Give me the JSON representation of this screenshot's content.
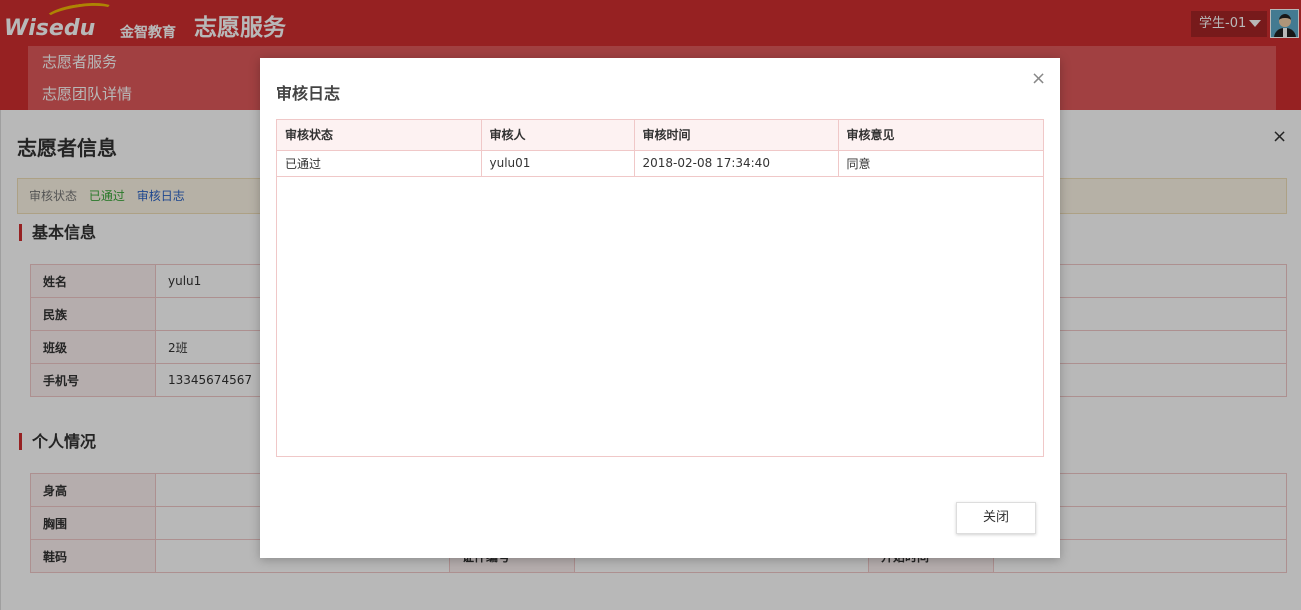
{
  "header": {
    "logo_text": "Wisedu",
    "logo_cn": "金智教育",
    "app_title": "志愿服务",
    "user_name": "学生-01"
  },
  "nav": {
    "items": [
      {
        "label": "志愿者服务"
      },
      {
        "label": "志愿团队详情"
      }
    ]
  },
  "panel": {
    "title": "志愿者信息",
    "close_symbol": "×",
    "status_label": "审核状态",
    "status_value": "已通过",
    "status_link": "审核日志",
    "sections": {
      "basic": "基本信息",
      "personal": "个人情况"
    },
    "basic_rows": [
      {
        "key": "姓名",
        "value": "yulu1"
      },
      {
        "key": "民族",
        "value": ""
      },
      {
        "key": "班级",
        "value": "2班"
      },
      {
        "key": "手机号",
        "value": "13345674567"
      }
    ],
    "personal_rows": [
      {
        "key": "身高",
        "value": "",
        "key2": "",
        "key3": ""
      },
      {
        "key": "胸围",
        "value": "",
        "key2": "",
        "key3": ""
      },
      {
        "key": "鞋码",
        "value": "",
        "key2": "证件编号",
        "key3": "开始时间"
      }
    ]
  },
  "modal": {
    "title": "审核日志",
    "close_symbol": "×",
    "columns": [
      "审核状态",
      "审核人",
      "审核时间",
      "审核意见"
    ],
    "rows": [
      [
        "已通过",
        "yulu01",
        "2018-02-08 17:34:40",
        "同意"
      ]
    ],
    "close_button": "关闭"
  },
  "colors": {
    "brand_red": "#d02f30",
    "nav_red": "#e0595a",
    "status_green": "#3aa83a",
    "link_blue": "#2c64c6"
  }
}
